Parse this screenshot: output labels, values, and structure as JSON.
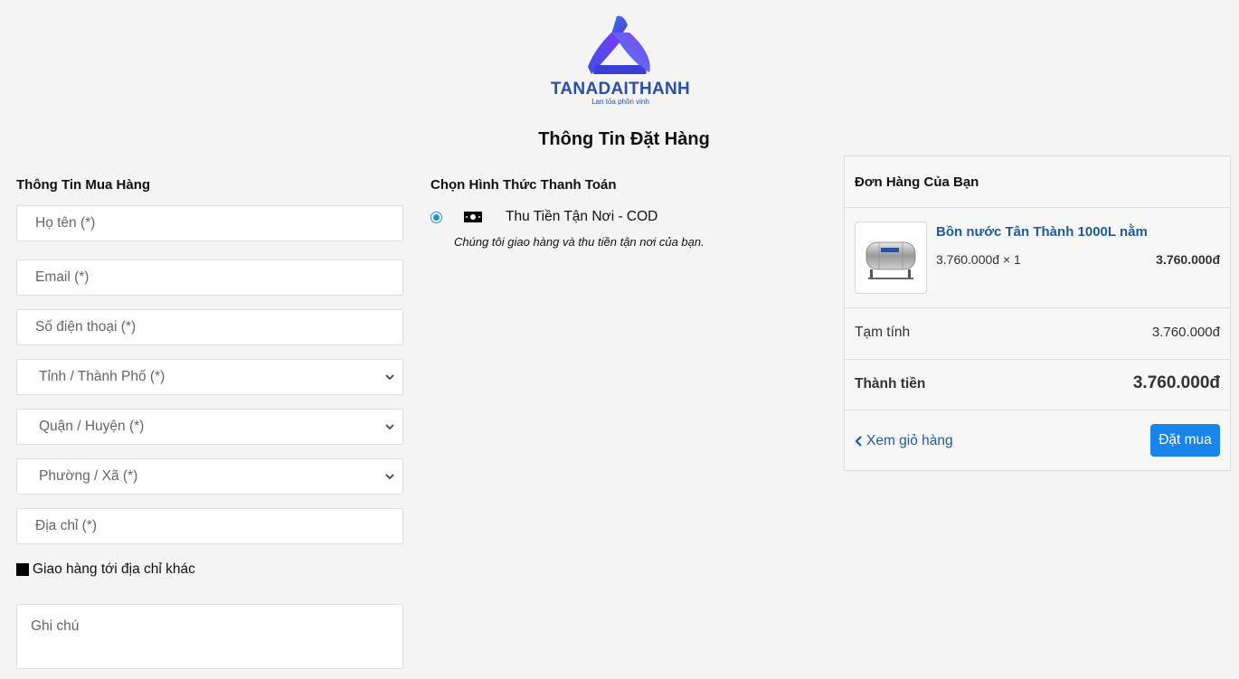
{
  "brand": {
    "name": "TANADAITHANH",
    "slogan": "Lan tỏa phồn vinh"
  },
  "page_title": "Thông Tin Đặt Hàng",
  "billing": {
    "title": "Thông Tin Mua Hàng",
    "name_placeholder": "Họ tên (*)",
    "email_placeholder": "Email (*)",
    "phone_placeholder": "Số điện thoại (*)",
    "province_placeholder": "Tỉnh / Thành Phố (*)",
    "district_placeholder": "Quận / Huyện (*)",
    "ward_placeholder": "Phường / Xã (*)",
    "address_placeholder": "Địa chỉ (*)",
    "ship_other_label": "Giao hàng tới địa chỉ khác",
    "note_placeholder": "Ghi chú"
  },
  "payment": {
    "title": "Chọn Hình Thức Thanh Toán",
    "method_label": "Thu Tiền Tận Nơi - COD",
    "method_desc": "Chúng tôi giao hàng và thu tiền tận nơi của bạn.",
    "icon": "money-icon"
  },
  "order": {
    "title": "Đơn Hàng Của Bạn",
    "product_name": "Bồn nước Tân Thành 1000L nằm",
    "product_qty": "3.760.000đ × 1",
    "product_price": "3.760.000đ",
    "subtotal_label": "Tạm tính",
    "subtotal_value": "3.760.000đ",
    "total_label": "Thành tiền",
    "total_value": "3.760.000đ",
    "back_label": "Xem giỏ hàng",
    "submit_label": "Đặt mua"
  },
  "colors": {
    "accent": "#1a85e8",
    "link": "#1e5a9e",
    "background": "#f4f4f4"
  }
}
